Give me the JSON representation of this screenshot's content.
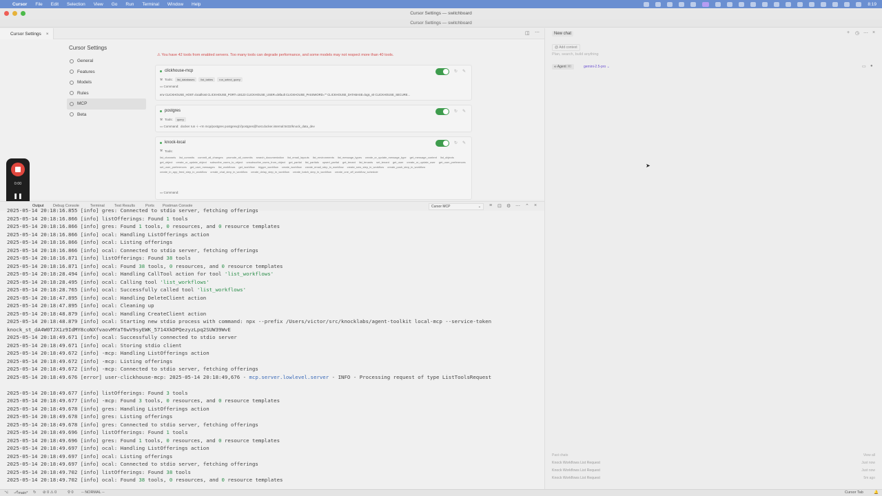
{
  "menubar": {
    "app": "Cursor",
    "items": [
      "File",
      "Edit",
      "Selection",
      "View",
      "Go",
      "Run",
      "Terminal",
      "Window",
      "Help"
    ],
    "time": "8:19"
  },
  "window": {
    "title": "Cursor Settings — switchboard",
    "subtitle": "Cursor Settings — switchboard"
  },
  "editor": {
    "tab_label": "Cursor Settings"
  },
  "settings": {
    "title": "Cursor Settings",
    "nav": [
      {
        "label": "General",
        "active": false
      },
      {
        "label": "Features",
        "active": false
      },
      {
        "label": "Models",
        "active": false
      },
      {
        "label": "Rules",
        "active": false
      },
      {
        "label": "MCP",
        "active": true
      },
      {
        "label": "Beta",
        "active": false
      }
    ],
    "warning": "You have 42 tools from enabled servers. Too many tools can degrade performance, and some models may not respect more than 40 tools.",
    "servers": [
      {
        "name": "clickhouse-mcp",
        "tools_label": "Tools:",
        "tools": [
          "list_databases",
          "list_tables",
          "run_select_query"
        ],
        "command_label": "Command:",
        "command": "env CLICKHOUSE_HOST=localhost CLICKHOUSE_PORT=18123 CLICKHOUSE_USER=default CLICKHOUSE_PASSWORD=\"\" CLICKHOUSE_DATABASE=logs_v0 CLICKHOUSE_SECURE..."
      },
      {
        "name": "postgres",
        "tools_label": "Tools:",
        "tools": [
          "query"
        ],
        "command_label": "Command:",
        "command": "docker run -i --rm mcp/postgres postgresql://postgres@host.docker.internal:5432/knock_data_dev"
      },
      {
        "name": "knock-local",
        "tools_label": "Tools:",
        "tools": [
          "list_channels",
          "list_commits",
          "commit_all_changes",
          "promote_all_commits",
          "search_documentation",
          "list_email_layouts",
          "list_environments",
          "list_message_types",
          "create_or_update_message_type",
          "get_message_content",
          "list_objects",
          "get_object",
          "create_or_update_object",
          "subscribe_users_to_object",
          "unsubscribe_users_from_object",
          "get_partial",
          "list_partials",
          "upsert_partial",
          "get_tenant",
          "list_tenants",
          "set_tenant",
          "get_user",
          "create_or_update_user",
          "get_user_preferences",
          "set_user_preferences",
          "get_user_messages",
          "list_workflows",
          "get_workflow",
          "trigger_workflow",
          "create_workflow",
          "create_email_step_in_workflow",
          "create_sms_step_in_workflow",
          "create_push_step_in_workflow",
          "create_in_app_feed_step_in_workflow",
          "create_chat_step_in_workflow",
          "create_delay_step_in_workflow",
          "create_batch_step_in_workflow",
          "create_one_off_workflow_schedule"
        ],
        "command_label": "Command:"
      }
    ]
  },
  "recorder": {
    "time": "0:00",
    "pause_icon": "pause-icon",
    "restart_icon": "restart-icon"
  },
  "panel": {
    "tabs": [
      "Output",
      "Debug Console",
      "Terminal",
      "Test Results",
      "Ports",
      "Postman Console"
    ],
    "active_tab": "Output",
    "output_channel": "Cursor MCP"
  },
  "log_lines": [
    "2025-05-14 20:18:16.855 [info] gres: Connected to stdio server, fetching offerings",
    "2025-05-14 20:18:16.866 [info] listOfferings: Found 1 tools",
    "2025-05-14 20:18:16.866 [info] gres: Found 1 tools, 0 resources, and 0 resource templates",
    "2025-05-14 20:18:16.866 [info] ocal: Handling ListOfferings action",
    "2025-05-14 20:18:16.866 [info] ocal: Listing offerings",
    "2025-05-14 20:18:16.866 [info] ocal: Connected to stdio server, fetching offerings",
    "2025-05-14 20:18:16.871 [info] listOfferings: Found 38 tools",
    "2025-05-14 20:18:16.871 [info] ocal: Found 38 tools, 0 resources, and 0 resource templates",
    "2025-05-14 20:18:28.494 [info] ocal: Handling CallTool action for tool 'list_workflows'",
    "2025-05-14 20:18:28.495 [info] ocal: Calling tool 'list_workflows'",
    "2025-05-14 20:18:28.765 [info] ocal: Successfully called tool 'list_workflows'",
    "2025-05-14 20:18:47.895 [info] ocal: Handling DeleteClient action",
    "2025-05-14 20:18:47.895 [info] ocal: Cleaning up",
    "2025-05-14 20:18:48.879 [info] ocal: Handling CreateClient action",
    "2025-05-14 20:18:48.879 [info] ocal: Starting new stdio process with command: npx --prefix /Users/victor/src/knocklabs/agent-toolkit local-mcp --service-token",
    "knock_st_dA4W0TJX1z9IdMY8coNXfvaovMYaT6wV9syEWK_5714XkDPQezyzLpq2SUW39WvE",
    "2025-05-14 20:18:49.671 [info] ocal: Successfully connected to stdio server",
    "2025-05-14 20:18:49.671 [info] ocal: Storing stdio client",
    "2025-05-14 20:18:49.672 [info] -mcp: Handling ListOfferings action",
    "2025-05-14 20:18:49.672 [info] -mcp: Listing offerings",
    "2025-05-14 20:18:49.672 [info] -mcp: Connected to stdio server, fetching offerings",
    "2025-05-14 20:18:49.676 [error] user-clickhouse-mcp: 2025-05-14 20:18:49,676 - mcp.server.lowlevel.server - INFO - Processing request of type ListToolsRequest",
    "",
    "2025-05-14 20:18:49.677 [info] listOfferings: Found 3 tools",
    "2025-05-14 20:18:49.677 [info] -mcp: Found 3 tools, 0 resources, and 0 resource templates",
    "2025-05-14 20:18:49.678 [info] gres: Handling ListOfferings action",
    "2025-05-14 20:18:49.678 [info] gres: Listing offerings",
    "2025-05-14 20:18:49.678 [info] gres: Connected to stdio server, fetching offerings",
    "2025-05-14 20:18:49.696 [info] listOfferings: Found 1 tools",
    "2025-05-14 20:18:49.696 [info] gres: Found 1 tools, 0 resources, and 0 resource templates",
    "2025-05-14 20:18:49.697 [info] ocal: Handling ListOfferings action",
    "2025-05-14 20:18:49.697 [info] ocal: Listing offerings",
    "2025-05-14 20:18:49.697 [info] ocal: Connected to stdio server, fetching offerings",
    "2025-05-14 20:18:49.702 [info] listOfferings: Found 38 tools",
    "2025-05-14 20:18:49.702 [info] ocal: Found 38 tools, 0 resources, and 0 resource templates"
  ],
  "statusbar": {
    "branch": "main*",
    "problems": "⊘ 0 ⚠ 0",
    "ports": "⚲ 0",
    "mode": "-- NORMAL --",
    "right": "Cursor Tab"
  },
  "chat": {
    "tab_title": "New chat",
    "add_context": "Add context",
    "placeholder": "Plan, search, build anything",
    "agent_label": "Agent",
    "agent_shortcut": "⌘I",
    "model": "gemini-2.5-pro",
    "past_chats_label": "Past chats",
    "view_all": "View all",
    "past_chats": [
      {
        "title": "Knock Workflows List Request",
        "time": "Just now"
      },
      {
        "title": "Knock Workflows List Request",
        "time": "Just now"
      },
      {
        "title": "Knock Workflows List Request",
        "time": "5m ago"
      }
    ]
  },
  "colors": {
    "menubar": "#6a8fd1",
    "toggle_on": "#3e9c4d",
    "warning": "#d24b4b",
    "record": "#e0473e",
    "model": "#6a4fd1"
  }
}
